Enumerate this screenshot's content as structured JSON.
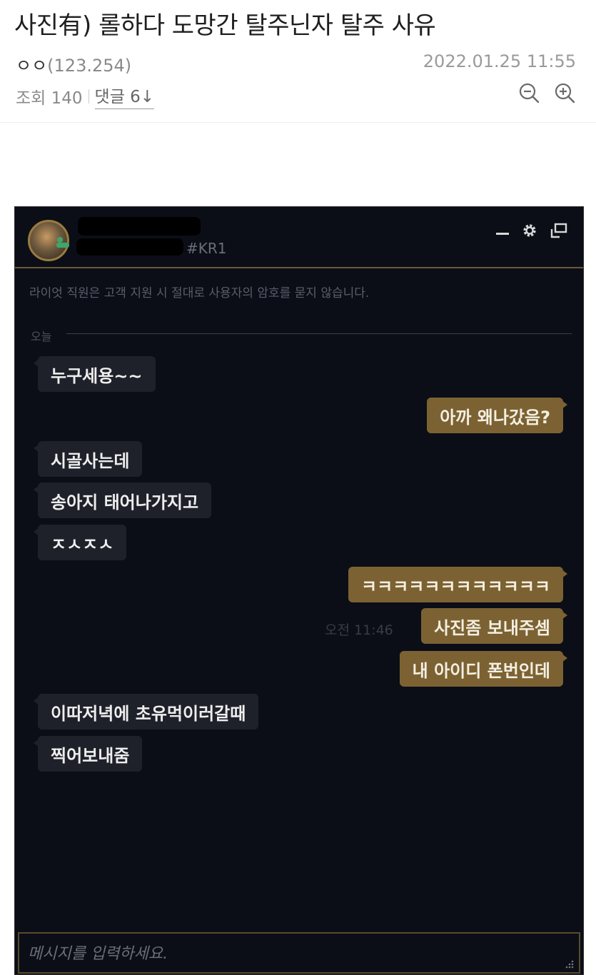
{
  "post": {
    "title": "사진有) 롤하다 도망간 탈주닌자 탈주 사유",
    "author_name": "ㅇㅇ",
    "author_ip": "(123.254)",
    "date": "2022.01.25 11:55",
    "views_label": "조회 140",
    "comments_label": "댓글 6↓",
    "zoom_out_icon": "zoom-out-icon",
    "zoom_in_icon": "zoom-in-icon"
  },
  "chat": {
    "tag": "#KR1",
    "notice": "라이엇 직원은 고객 지원 시 절대로 사용자의 암호를 묻지 않습니다.",
    "day_divider": "오늘",
    "controls": [
      "minimize-icon",
      "settings-gear-icon",
      "popout-window-icon"
    ],
    "messages": [
      {
        "side": "in",
        "text": "누구세용~~"
      },
      {
        "side": "out",
        "text": "아까 왜나갔음?"
      },
      {
        "side": "in",
        "text": "시골사는데"
      },
      {
        "side": "in",
        "text": "송아지 태어나가지고"
      },
      {
        "side": "in",
        "text": "ㅈㅅㅈㅅ"
      },
      {
        "side": "out",
        "text": "ㅋㅋㅋㅋㅋㅋㅋㅋㅋㅋㅋㅋ"
      },
      {
        "side": "out",
        "text": "사진좀 보내주셈"
      },
      {
        "side": "out",
        "text": "내 아이디 폰번인데"
      },
      {
        "side": "in",
        "text": "이따저녁에 초유먹이러갈때"
      },
      {
        "side": "in",
        "text": "찍어보내줌"
      }
    ],
    "time": "오전 11:46",
    "input_placeholder": "메시지를 입력하세요.",
    "colors": {
      "background": "#0b0e17",
      "incoming_bubble": "#1e2129",
      "outgoing_bubble": "#7c6232",
      "gold_accent": "#6b5a36"
    }
  }
}
